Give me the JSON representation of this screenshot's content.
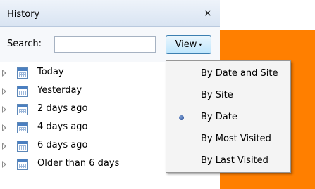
{
  "panel": {
    "title": "History",
    "close_glyph": "×"
  },
  "search": {
    "label": "Search:",
    "value": "",
    "placeholder": ""
  },
  "view_button": {
    "label": "View",
    "arrow": "▾"
  },
  "tree": {
    "items": [
      {
        "label": "Today",
        "icon": "calendar-icon"
      },
      {
        "label": "Yesterday",
        "icon": "calendar-icon"
      },
      {
        "label": "2 days ago",
        "icon": "calendar-icon"
      },
      {
        "label": "4 days ago",
        "icon": "calendar-icon"
      },
      {
        "label": "6 days ago",
        "icon": "calendar-icon"
      },
      {
        "label": "Older than 6 days",
        "icon": "calendar-icon"
      }
    ]
  },
  "view_menu": {
    "items": [
      {
        "label": "By Date and Site",
        "selected": false
      },
      {
        "label": "By Site",
        "selected": false
      },
      {
        "label": "By Date",
        "selected": true
      },
      {
        "label": "By Most Visited",
        "selected": false
      },
      {
        "label": "By Last Visited",
        "selected": false
      }
    ]
  },
  "colors": {
    "content_background": "#ff7f00",
    "button_border": "#3c7fb1"
  }
}
